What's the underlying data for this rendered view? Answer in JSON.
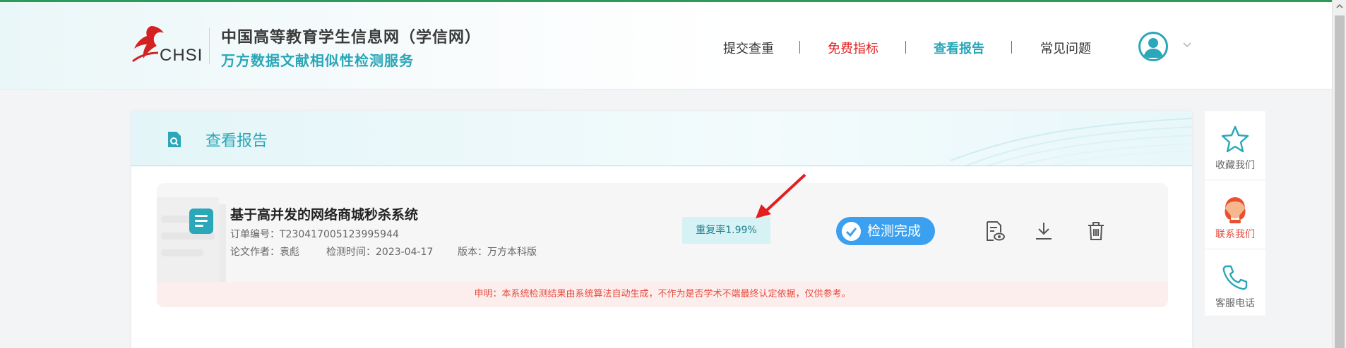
{
  "header": {
    "logo_text": "CHSI",
    "brand_line1": "中国高等教育学生信息网（学信网）",
    "brand_line2": "万方数据文献相似性检测服务",
    "nav": [
      {
        "label": "提交查重",
        "color": "#333333"
      },
      {
        "label": "免费指标",
        "color": "#e02020"
      },
      {
        "label": "查看报告",
        "color": "#2aa7b8"
      },
      {
        "label": "常见问题",
        "color": "#333333"
      }
    ],
    "accent_color": "#2aa7b8",
    "user_icon": "user-avatar-icon",
    "menu_icon": "chevron-down-icon"
  },
  "panel": {
    "title": "查看报告",
    "title_icon": "report-search-icon"
  },
  "report": {
    "paper_title": "基于高并发的网络商城秒杀系统",
    "order_label": "订单编号：",
    "order_number": "T230417005123995944",
    "author_label": "论文作者：",
    "author": "袁彪",
    "time_label": "检测时间：",
    "time": "2023-04-17",
    "version_label": "版本：",
    "version": "万方本科版",
    "rate_label": "重复率1.99%",
    "status": "检测完成",
    "status_color": "#3aa0ef",
    "actions": [
      {
        "icon": "view-report-icon"
      },
      {
        "icon": "download-icon"
      },
      {
        "icon": "trash-icon"
      }
    ],
    "disclaimer": "申明：本系统检测结果由系统算法自动生成，不作为是否学术不端最终认定依据，仅供参考。"
  },
  "sidebar": {
    "items": [
      {
        "label": "收藏我们",
        "icon": "star-icon"
      },
      {
        "label": "联系我们",
        "icon": "customer-service-icon",
        "color": "#e64a3b"
      },
      {
        "label": "客服电话",
        "icon": "phone-icon"
      }
    ]
  }
}
